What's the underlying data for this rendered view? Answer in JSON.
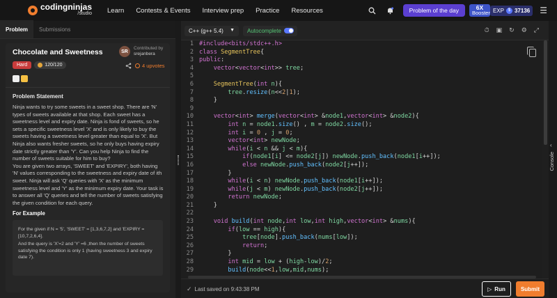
{
  "brand": {
    "name": "codingninjas",
    "sub": "/studio"
  },
  "nav": [
    "Learn",
    "Contests & Events",
    "Interview prep",
    "Practice",
    "Resources"
  ],
  "header": {
    "potd_label": "Problem of the day",
    "booster_line1": "6X",
    "booster_line2": "Booster",
    "exp_label": "EXP",
    "exp_value": "37136",
    "search_icon": "search-icon",
    "notification_icon": "bell-icon",
    "menu_icon": "menu-icon"
  },
  "left_tabs": [
    "Problem",
    "Submissions"
  ],
  "problem": {
    "title": "Chocolate and Sweetness",
    "difficulty": "Hard",
    "score": "120/120",
    "author_initials": "SR",
    "author_prefix": "Contributed by",
    "author_name": "srejanbera",
    "upvotes": "4 upvotes",
    "statement_heading": "Problem Statement",
    "statement_p1": "Ninja wants to try some sweets in a sweet shop. There are 'N' types of sweets available at that shop. Each sweet has a sweetness level and expiry date. Ninja is fond of sweets, so he sets a specific sweetness level 'X' and is only likely to buy the sweets having a sweetness level greater than equal to 'X'. But Ninja also wants fresher sweets, so he only buys having expiry date strictly greater than 'Y'. Can you help Ninja to find the number of sweets suitable for him to buy?",
    "statement_p2": "You are given two arrays, 'SWEET' and 'EXPIRY', both having 'N' values corresponding to the sweetness and expiry date of ith sweet. Ninja will ask 'Q' queries with 'X' as the minimum sweetness level and 'Y' as the minimum expiry date. Your task is to answer all 'Q' queries and tell the number of sweets satisfying the given condition for each query.",
    "example_heading": "For Example",
    "example_p1": "For the given if N = '5', 'SWEET' = [1,3,6,7,2] and 'EXPIRY = [10,7,2,6,4].",
    "example_p2": "And the query is 'X'=2  and  'Y' =6 ,then the number of sweets satisfying the condition is only 1 (having sweetness 3 and expiry date 7)."
  },
  "editor": {
    "language": "C++ (g++ 5.4)",
    "autocomplete": "Autocomplete",
    "code": [
      "#include<bits/stdc++.h>",
      "class SegmentTree{",
      "public:",
      "    vector<vector<int>> tree;",
      "",
      "    SegmentTree(int n){",
      "        tree.resize(n<<2|1);",
      "    }",
      "",
      "    vector<int> merge(vector<int> &node1,vector<int> &node2){",
      "        int n = node1.size() , m = node2.size();",
      "        int i = 0 , j = 0;",
      "        vector<int> newNode;",
      "        while(i < n && j < m){",
      "            if(node1[i] <= node2[j]) newNode.push_back(node1[i++]);",
      "            else newNode.push_back(node2[j++]);",
      "        }",
      "        while(i < n) newNode.push_back(node1[i++]);",
      "        while(j < m) newNode.push_back(node2[j++]);",
      "        return newNode;",
      "    }",
      "",
      "    void build(int node,int low,int high,vector<int> &nums){",
      "        if(low == high){",
      "            tree[node].push_back(nums[low]);",
      "            return;",
      "        }",
      "        int mid = low + (high-low)/2;",
      "        build(node<<1,low,mid,nums);"
    ],
    "saved_text": "Last saved on 9:43:38 PM",
    "run_label": "Run",
    "submit_label": "Submit",
    "console_label": "Console"
  }
}
